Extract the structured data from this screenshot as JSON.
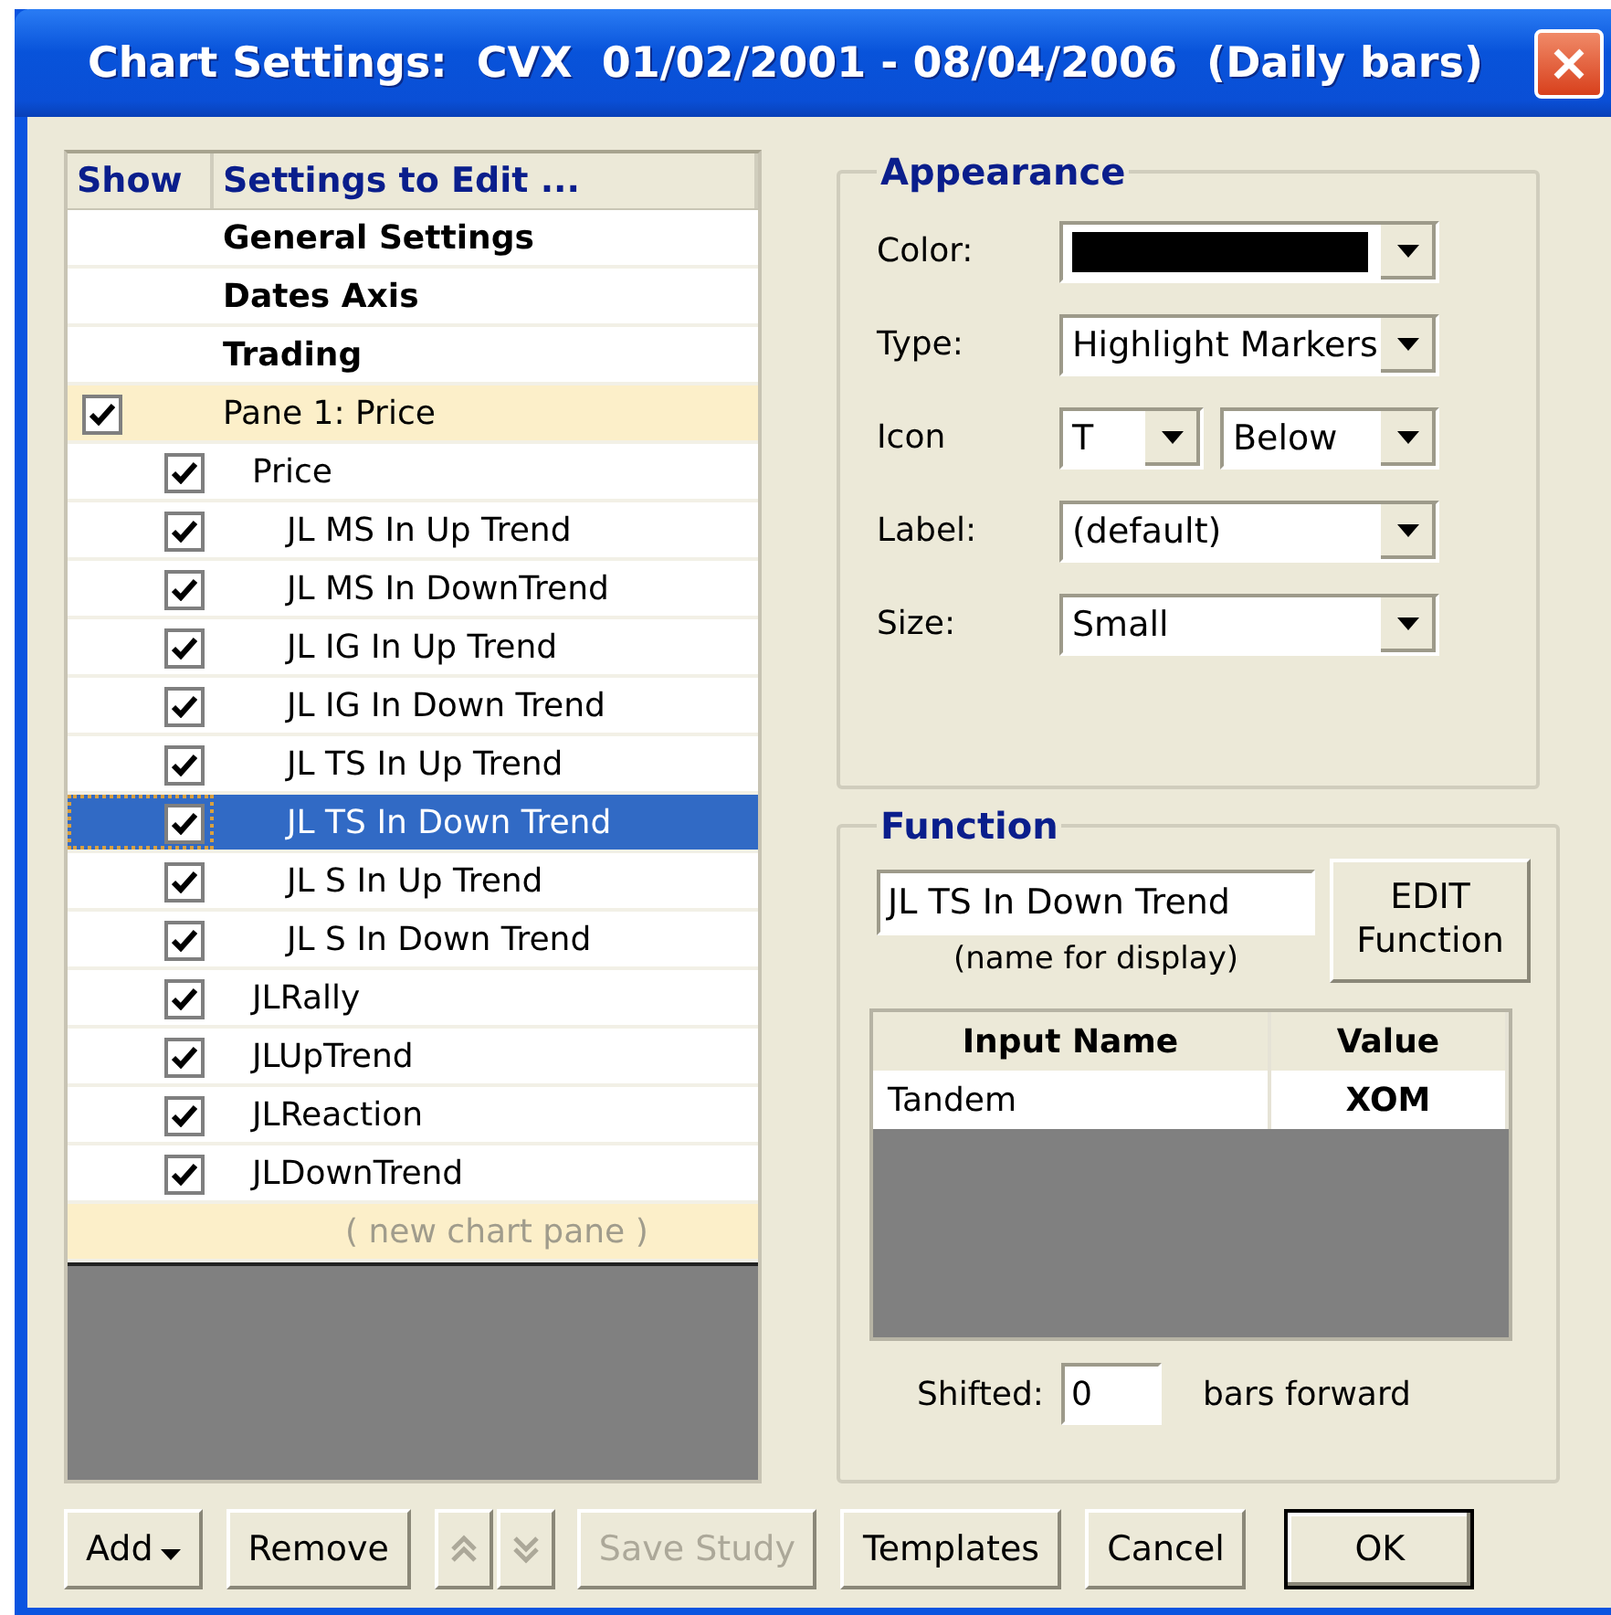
{
  "window": {
    "title": "Chart Settings:  CVX  01/02/2001 - 08/04/2006  (Daily bars)"
  },
  "list": {
    "columns": [
      "Show",
      "Settings to Edit ..."
    ],
    "items": [
      {
        "kind": "section",
        "label": "General Settings",
        "selected": false
      },
      {
        "kind": "section",
        "label": "Dates Axis",
        "selected": false
      },
      {
        "kind": "section",
        "label": "Trading",
        "selected": false
      },
      {
        "kind": "pane",
        "label": "Pane 1:  Price",
        "checked": true,
        "selected": false,
        "children": [
          {
            "kind": "study",
            "label": "Price",
            "checked": true,
            "selected": false,
            "children": [
              {
                "kind": "study",
                "label": "JL MS In Up Trend",
                "checked": true,
                "selected": false
              },
              {
                "kind": "study",
                "label": "JL MS In DownTrend",
                "checked": true,
                "selected": false
              },
              {
                "kind": "study",
                "label": "JL IG In Up Trend",
                "checked": true,
                "selected": false
              },
              {
                "kind": "study",
                "label": "JL IG In Down Trend",
                "checked": true,
                "selected": false
              },
              {
                "kind": "study",
                "label": "JL TS In Up Trend",
                "checked": true,
                "selected": false
              },
              {
                "kind": "study",
                "label": "JL TS In Down Trend",
                "checked": true,
                "selected": true
              },
              {
                "kind": "study",
                "label": "JL S In Up Trend",
                "checked": true,
                "selected": false
              },
              {
                "kind": "study",
                "label": "JL S In Down Trend",
                "checked": true,
                "selected": false
              }
            ]
          },
          {
            "kind": "study",
            "label": "JLRally",
            "checked": true,
            "selected": false
          },
          {
            "kind": "study",
            "label": "JLUpTrend",
            "checked": true,
            "selected": false
          },
          {
            "kind": "study",
            "label": "JLReaction",
            "checked": true,
            "selected": false
          },
          {
            "kind": "study",
            "label": "JLDownTrend",
            "checked": true,
            "selected": false
          }
        ]
      },
      {
        "kind": "new",
        "label": "( new chart pane )",
        "selected": false
      }
    ]
  },
  "appearance": {
    "title": "Appearance",
    "fields": [
      {
        "kind": "color",
        "label": "Color:",
        "color": "#000000"
      },
      {
        "kind": "combo",
        "label": "Type:",
        "value": "Highlight Markers"
      },
      {
        "kind": "pair",
        "label": "Icon",
        "values": [
          "T",
          "Below"
        ]
      },
      {
        "kind": "combo",
        "label": "Label:",
        "value": "(default)"
      },
      {
        "kind": "combo",
        "label": "Size:",
        "value": "Small"
      }
    ]
  },
  "function": {
    "title": "Function",
    "name_value": "JL TS In Down Trend",
    "name_caption": "(name for display)",
    "edit_button": [
      "EDIT",
      "Function"
    ],
    "table": {
      "columns": [
        "Input Name",
        "Value"
      ],
      "rows": [
        [
          "Tandem",
          "XOM"
        ]
      ]
    },
    "shift_label": "Shifted:",
    "shift_value": "0",
    "shift_suffix": "bars forward"
  },
  "buttons": [
    {
      "kind": "dropdown",
      "label": "Add",
      "disabled": false
    },
    {
      "kind": "plain",
      "label": "Remove",
      "disabled": false
    },
    {
      "kind": "move",
      "disabled": true
    },
    {
      "kind": "plain",
      "label": "Save Study",
      "disabled": true
    },
    {
      "kind": "plain",
      "label": "Templates",
      "disabled": false
    },
    {
      "kind": "plain",
      "label": "Cancel",
      "disabled": false
    },
    {
      "kind": "default",
      "label": "OK",
      "disabled": false
    }
  ]
}
